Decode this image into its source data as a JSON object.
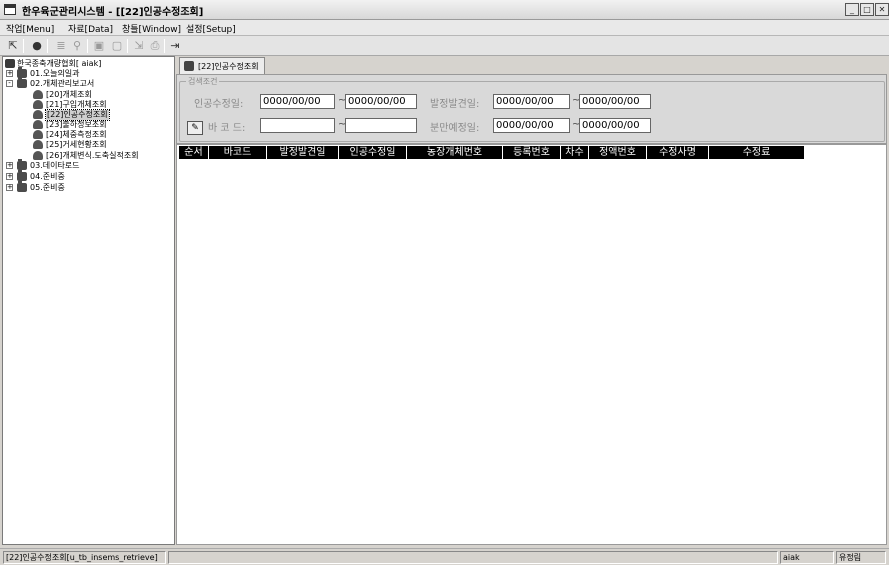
{
  "window": {
    "title": "한우육군관리시스템 - [[22]인공수정조회]",
    "buttons": {
      "minimize": "_",
      "restore": "□",
      "close": "✕"
    }
  },
  "menu": [
    "작업[Menu]",
    "자료[Data]",
    "창틀[Window]",
    "설정[Setup]"
  ],
  "toolbar": {
    "icons": [
      "pointer-icon",
      "stop-icon",
      "print-icon",
      "search-icon",
      "save-icon",
      "new-icon",
      "export-icon",
      "printer-icon",
      "exit-icon"
    ]
  },
  "tree": {
    "root": "한국종축개량협회[ aiak]",
    "nodes": [
      {
        "label": "01.오늘의일과",
        "expander": "+"
      },
      {
        "label": "02.개체관리보고서",
        "expander": "-"
      },
      {
        "label": "[20]개체조회"
      },
      {
        "label": "[21]구입개체조회"
      },
      {
        "label": "[22]인공수정조회",
        "selected": true
      },
      {
        "label": "[23]출하정보조회"
      },
      {
        "label": "[24]체중측정조회"
      },
      {
        "label": "[25]거세현황조회"
      },
      {
        "label": "[26]개체변식.도축실적조회"
      },
      {
        "label": "03.데이타로드",
        "expander": "+"
      },
      {
        "label": "04.준비중",
        "expander": "+"
      },
      {
        "label": "05.준비중",
        "expander": "+"
      }
    ]
  },
  "tab": {
    "label": "[22]인공수정조회"
  },
  "search": {
    "legend": "검색조건",
    "insem_date_label": "인공수정일:",
    "insem_from": "0000/00/00",
    "insem_to": "0000/00/00",
    "estrus_date_label": "발정발견일:",
    "estrus_from": "0000/00/00",
    "estrus_to": "0000/00/00",
    "barcode_label": "바 코 드:",
    "barcode_from": "",
    "barcode_to": "",
    "calving_date_label": "분만예정일:",
    "calving_from": "0000/00/00",
    "calving_to": "0000/00/00",
    "tilde": "~"
  },
  "grid": {
    "columns": [
      "순서",
      "바코드",
      "발정발견일",
      "인공수정일",
      "농장개체번호",
      "등록번호",
      "차수",
      "정액번호",
      "수정사명",
      "수정료"
    ]
  },
  "status": {
    "left": "[22]인공수정조회[u_tb_insems_retrieve]",
    "user": "aiak",
    "right": "유정림"
  }
}
